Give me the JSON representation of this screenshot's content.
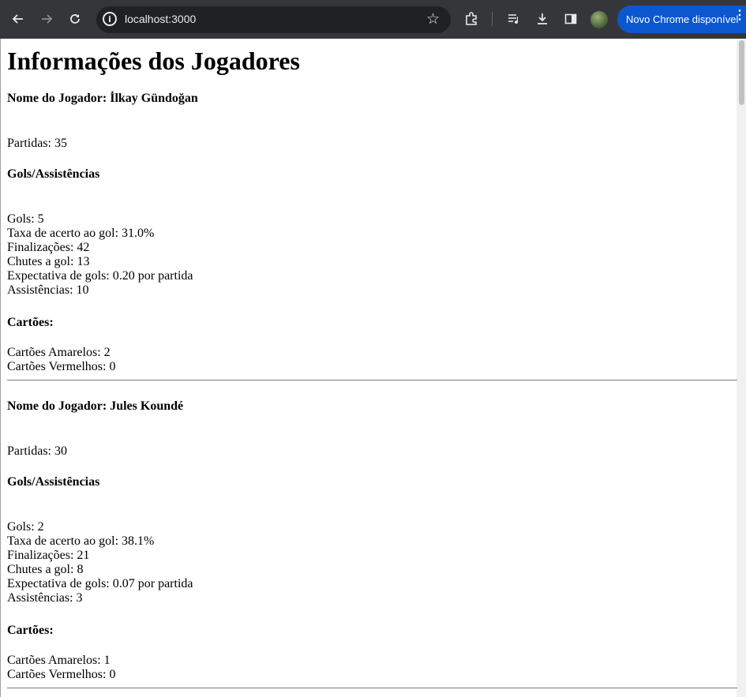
{
  "browser": {
    "url": "localhost:3000",
    "update_label": "Novo Chrome disponível"
  },
  "page": {
    "title": "Informações dos Jogadores",
    "players": [
      {
        "name": "Nome do Jogador: İlkay Gündoğan",
        "partidas": "Partidas: 35",
        "gols_header": "Gols/Assistências",
        "stats": [
          "Gols: 5",
          "Taxa de acerto ao gol: 31.0%",
          "Finalizações: 42",
          "Chutes a gol: 13",
          "Expectativa de gols: 0.20 por partida",
          "Assistências: 10"
        ],
        "cartoes_header": "Cartões:",
        "cartoes": [
          "Cartões Amarelos: 2",
          "Cartões Vermelhos: 0"
        ]
      },
      {
        "name": "Nome do Jogador: Jules Koundé",
        "partidas": "Partidas: 30",
        "gols_header": "Gols/Assistências",
        "stats": [
          "Gols: 2",
          "Taxa de acerto ao gol: 38.1%",
          "Finalizações: 21",
          "Chutes a gol: 8",
          "Expectativa de gols: 0.07 por partida",
          "Assistências: 3"
        ],
        "cartoes_header": "Cartões:",
        "cartoes": [
          "Cartões Amarelos: 1",
          "Cartões Vermelhos: 0"
        ]
      }
    ]
  },
  "icons": {
    "back": "arrow-left",
    "forward": "arrow-right",
    "reload": "reload",
    "info": "info",
    "star": "star",
    "extensions": "puzzle",
    "media": "playlist",
    "download": "download",
    "sidepanel": "side-panel",
    "avatar": "profile",
    "menu": "kebab"
  }
}
